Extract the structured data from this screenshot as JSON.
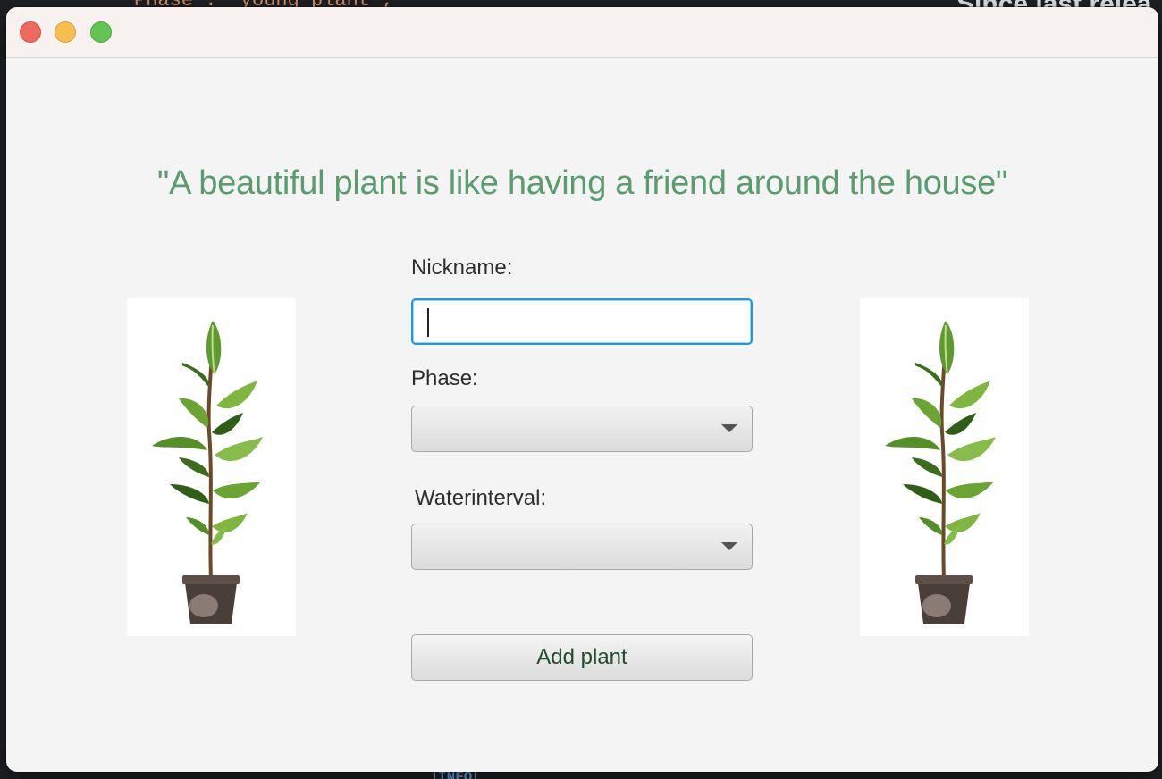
{
  "background": {
    "code_line": "Phase : 'young plant',",
    "heading_fragment": "Since last relea",
    "tag": "INFO"
  },
  "window": {
    "traffic_lights": [
      "close-button",
      "minimize-button",
      "zoom-button"
    ]
  },
  "quote": "\"A beautiful plant is like having a friend around the house\"",
  "form": {
    "nickname_label": "Nickname:",
    "nickname_value": "",
    "phase_label": "Phase:",
    "phase_value": "",
    "waterinterval_label": "Waterinterval:",
    "waterinterval_value": "",
    "add_button_label": "Add plant"
  },
  "images": {
    "left": "potted-plant-illustration",
    "right": "potted-plant-illustration"
  },
  "colors": {
    "quote": "#5a9c6e",
    "focus_border": "#1d9ad6",
    "button_text": "#1f4d2e",
    "close": "#ee6a5f",
    "minimize": "#f5be4f",
    "zoom": "#62c554"
  }
}
